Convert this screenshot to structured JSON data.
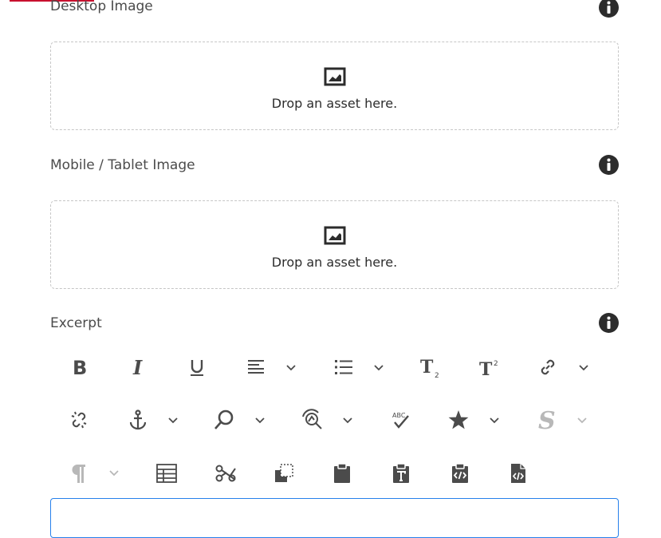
{
  "fields": {
    "desktop_image": {
      "label": "Desktop Image",
      "drop_text": "Drop an asset here."
    },
    "mobile_image": {
      "label": "Mobile / Tablet Image",
      "drop_text": "Drop an asset here."
    },
    "excerpt": {
      "label": "Excerpt"
    }
  },
  "toolbar": {
    "row1": [
      "bold-icon",
      "italic-icon",
      "underline-icon",
      "align-left-icon",
      "list-icon",
      "subscript-icon",
      "superscript-icon",
      "link-icon"
    ],
    "row2": [
      "unlink-icon",
      "anchor-icon",
      "find-icon",
      "find-replace-icon",
      "spellcheck-icon",
      "special-chars-icon",
      "styles-icon"
    ],
    "row3": [
      "paragraph-format-icon",
      "table-icon",
      "cut-icon",
      "copy-icon",
      "paste-icon",
      "paste-text-icon",
      "paste-word-icon",
      "source-edit-icon"
    ],
    "disabled": [
      "styles-icon",
      "paragraph-format-icon"
    ]
  },
  "colors": {
    "icon": "#4b4b4b",
    "disabled_icon": "#b8b8b8",
    "focus_border": "#2680eb",
    "accent": "#c8102e"
  }
}
